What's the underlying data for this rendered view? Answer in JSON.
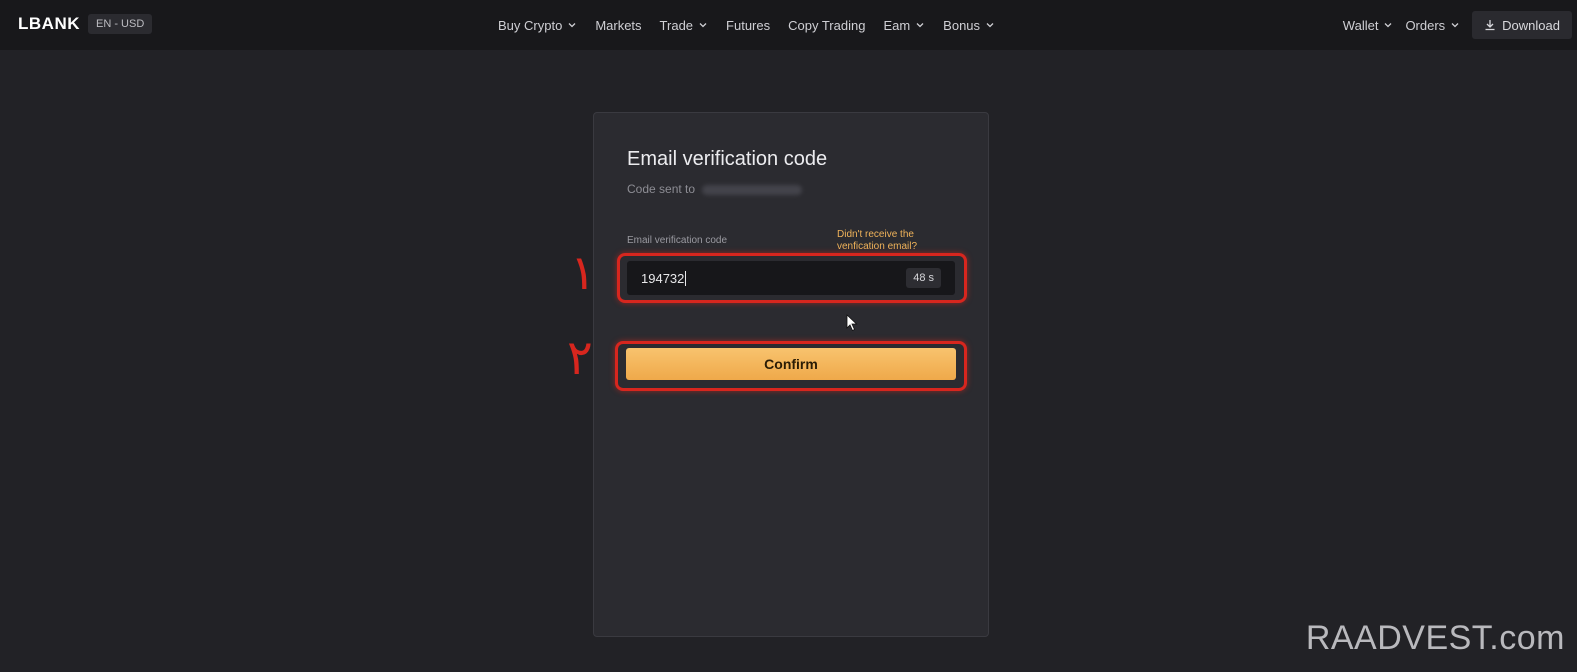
{
  "header": {
    "logo": "LBANK",
    "locale": "EN - USD",
    "nav": [
      {
        "label": "Buy Crypto",
        "has_menu": true
      },
      {
        "label": "Markets",
        "has_menu": false
      },
      {
        "label": "Trade",
        "has_menu": true
      },
      {
        "label": "Futures",
        "has_menu": false
      },
      {
        "label": "Copy Trading",
        "has_menu": false
      },
      {
        "label": "Eam",
        "has_menu": true
      },
      {
        "label": "Bonus",
        "has_menu": true
      }
    ],
    "wallet_label": "Wallet",
    "orders_label": "Orders",
    "download_label": "Download"
  },
  "verification": {
    "title": "Email verification code",
    "code_sent_prefix": "Code sent to",
    "field_label": "Email verification code",
    "resend_link": "Didn't receive the venfication email?",
    "code_value": "194732",
    "timer": "48 s",
    "confirm_label": "Confirm"
  },
  "annotations": {
    "marker_1": "١",
    "marker_2": "٢"
  },
  "watermark": "RAADVEST.com",
  "colors": {
    "background": "#222226",
    "card": "#2b2b30",
    "accent": "#f0b35a",
    "annotation": "#d7261e"
  }
}
